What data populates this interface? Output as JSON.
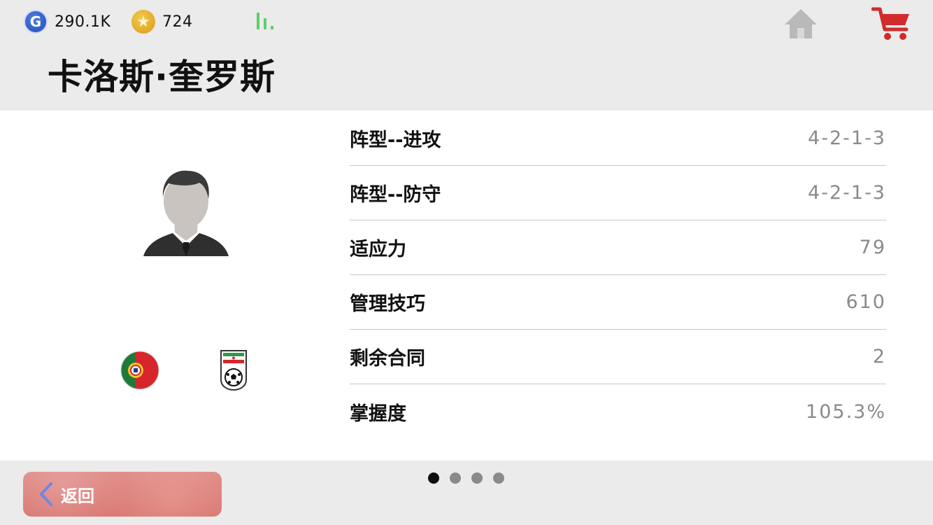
{
  "header": {
    "g_currency": {
      "icon": "g-coin-icon",
      "value": "290.1K",
      "glyph": "G"
    },
    "star_currency": {
      "icon": "star-coin-icon",
      "value": "724",
      "glyph": "★"
    },
    "signal_icon": "signal-icon",
    "home_icon": "home-icon",
    "cart_icon": "cart-icon",
    "title": "卡洛斯·奎罗斯"
  },
  "profile": {
    "avatar_icon": "manager-avatar-icon",
    "nationality_icon": "portugal-flag-icon",
    "team_icon": "iran-federation-badge-icon"
  },
  "stats": [
    {
      "label": "阵型--进攻",
      "value": "4-2-1-3"
    },
    {
      "label": "阵型--防守",
      "value": "4-2-1-3"
    },
    {
      "label": "适应力",
      "value": "79"
    },
    {
      "label": "管理技巧",
      "value": "610"
    },
    {
      "label": "剩余合同",
      "value": "2"
    },
    {
      "label": "掌握度",
      "value": "105.3%"
    }
  ],
  "footer": {
    "back_label": "返回",
    "back_icon": "chevron-left-icon",
    "page_count": 4,
    "active_page": 1
  },
  "colors": {
    "background": "#ebebeb",
    "panel": "#ffffff",
    "cart": "#d22b2b",
    "signal": "#5ecf6b",
    "back_button": "#da7a75",
    "home": "#b9b9b9"
  }
}
